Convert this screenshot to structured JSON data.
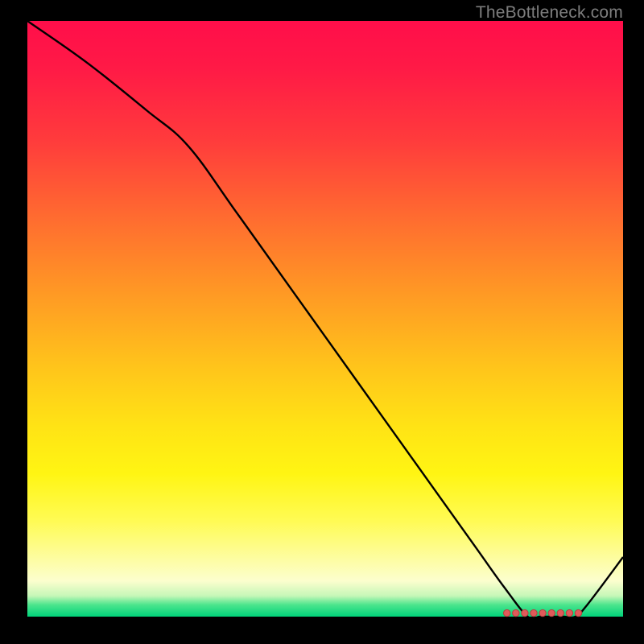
{
  "attribution": "TheBottleneck.com",
  "chart_data": {
    "type": "line",
    "title": "",
    "xlabel": "",
    "ylabel": "",
    "xlim": [
      0,
      100
    ],
    "ylim": [
      0,
      100
    ],
    "series": [
      {
        "name": "curve",
        "x": [
          0,
          10,
          20,
          27,
          35,
          45,
          55,
          65,
          75,
          80,
          84,
          86,
          88,
          90,
          92,
          94,
          100
        ],
        "y": [
          100,
          93,
          85,
          79,
          68,
          54,
          40,
          26,
          12,
          5,
          0,
          0,
          0,
          0,
          0,
          2,
          10
        ]
      }
    ],
    "markers": {
      "name": "sweet-spot",
      "x": [
        80.5,
        82,
        83.5,
        85,
        86.5,
        88,
        89.5,
        91,
        92.5
      ],
      "y": [
        0.6,
        0.6,
        0.6,
        0.6,
        0.6,
        0.6,
        0.6,
        0.6,
        0.6
      ]
    }
  },
  "colors": {
    "curve": "#000000",
    "marker_fill": "#e05a5a",
    "marker_stroke": "#b83e3e",
    "bg": "#000000"
  }
}
